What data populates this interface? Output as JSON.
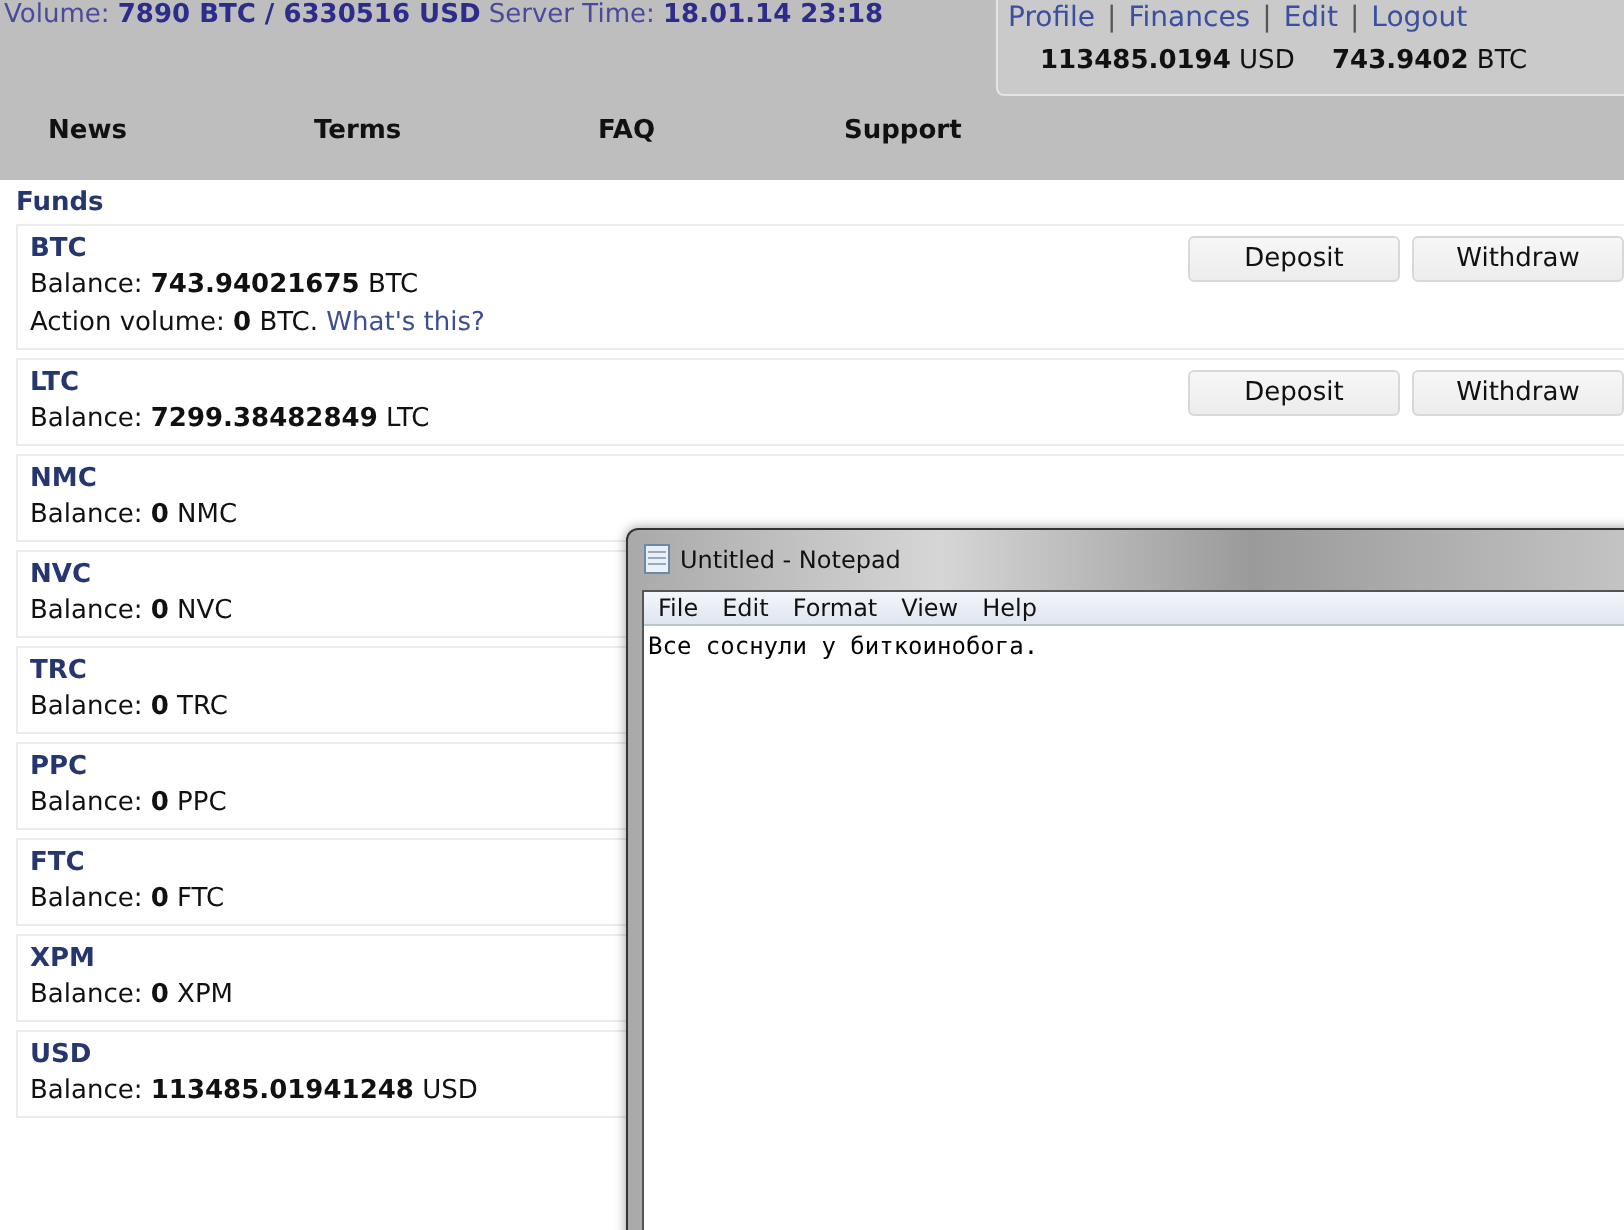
{
  "header": {
    "stats": "Volume: **7890 BTC / 6330516 USD** Server Time: **18.01.14 23:18**",
    "account_links": [
      "Profile",
      "Finances",
      "Edit",
      "Logout"
    ],
    "link_separator": "|",
    "balances": [
      {
        "amount": "113485.0194",
        "unit": "USD"
      },
      {
        "amount": "743.9402",
        "unit": "BTC"
      }
    ],
    "nav": [
      "News",
      "Terms",
      "FAQ",
      "Support"
    ]
  },
  "funds": {
    "title": "Funds",
    "items": [
      {
        "code": "BTC",
        "balance": "Balance: **743.94021675** BTC",
        "action": "Action volume: **0** BTC.",
        "action_link": "What's this?",
        "buttons": [
          "Deposit",
          "Withdraw"
        ]
      },
      {
        "code": "LTC",
        "balance": "Balance: **7299.38482849** LTC",
        "buttons": [
          "Deposit",
          "Withdraw"
        ]
      },
      {
        "code": "NMC",
        "balance": "Balance: **0** NMC"
      },
      {
        "code": "NVC",
        "balance": "Balance: **0** NVC"
      },
      {
        "code": "TRC",
        "balance": "Balance: **0** TRC"
      },
      {
        "code": "PPC",
        "balance": "Balance: **0** PPC"
      },
      {
        "code": "FTC",
        "balance": "Balance: **0** FTC"
      },
      {
        "code": "XPM",
        "balance": "Balance: **0** XPM"
      },
      {
        "code": "USD",
        "balance": "Balance: **113485.01941248** USD"
      }
    ]
  },
  "notepad": {
    "title": "Untitled - Notepad",
    "menu": [
      "File",
      "Edit",
      "Format",
      "View",
      "Help"
    ],
    "text": "Все соснули у биткоинобога."
  }
}
